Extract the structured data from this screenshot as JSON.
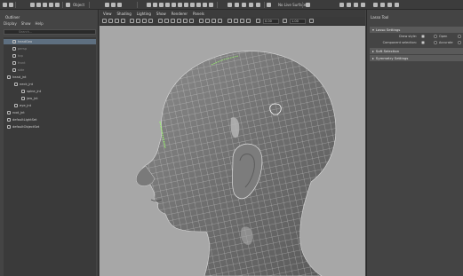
{
  "shelf": {
    "workspace_label": "Object",
    "symmetry_label": "No Live Surface"
  },
  "outliner": {
    "title": "Outliner",
    "menu": [
      "Display",
      "Show",
      "Help"
    ],
    "search_placeholder": "Search...",
    "nodes": [
      {
        "label": "headGeo",
        "selected": true
      },
      {
        "label": "persp",
        "selected": false,
        "dim": true
      },
      {
        "label": "top",
        "selected": false,
        "dim": true
      },
      {
        "label": "front",
        "selected": false,
        "dim": true
      },
      {
        "label": "side",
        "selected": false,
        "dim": true
      },
      {
        "label": "head_jnt",
        "selected": false
      },
      {
        "label": "neck_jnt",
        "selected": false
      },
      {
        "label": "spine_jnt",
        "selected": false
      },
      {
        "label": "jaw_jnt",
        "selected": false
      },
      {
        "label": "eye_jnt",
        "selected": false
      },
      {
        "label": "root_jnt",
        "selected": false
      },
      {
        "label": "defaultLightSet",
        "selected": false
      },
      {
        "label": "defaultObjectSet",
        "selected": false
      }
    ]
  },
  "viewport": {
    "menu": [
      "View",
      "Shading",
      "Lighting",
      "Show",
      "Renderer",
      "Panels"
    ],
    "gamma": "0.00",
    "exposure": "1.00"
  },
  "tool_settings": {
    "title": "Lasso Tool",
    "sections": {
      "lasso": "Lasso Settings",
      "soft": "Soft Selection",
      "symmetry": "Symmetry Settings"
    },
    "draw_style_label": "Draw style:",
    "draw_style_opts": [
      "Open"
    ],
    "component_selection_label": "Component selection:",
    "component_selection_opts": [
      "Accurate"
    ]
  },
  "colors": {
    "viewport_bg": "#a7a7a7",
    "panel_bg": "#444444",
    "selection": "#5e6f80",
    "wire": "#d8d8d8",
    "selected_edges": "#9bff6a"
  }
}
